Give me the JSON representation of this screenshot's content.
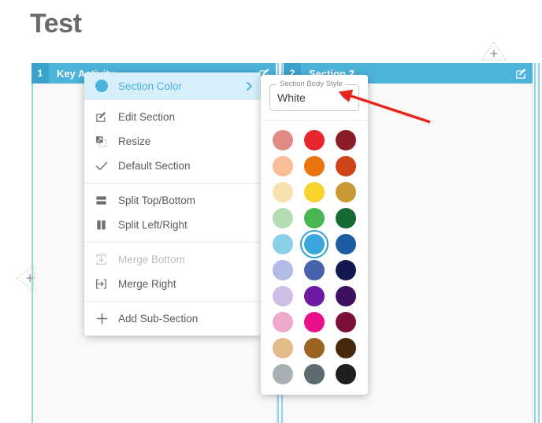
{
  "page": {
    "title": "Test"
  },
  "board": {
    "sections": [
      {
        "number": "1",
        "title": "Key Activity",
        "edit_icon": "edit-pencil-square-icon"
      },
      {
        "number": "2",
        "title": "Section 2",
        "edit_icon": "edit-pencil-square-icon"
      }
    ],
    "add_handles": [
      {
        "name": "add-section-top-handle",
        "icon": "plus-icon",
        "direction": "up"
      },
      {
        "name": "add-section-left-handle",
        "icon": "plus-icon",
        "direction": "left"
      }
    ],
    "colors": {
      "header_bar": "#4cb3da",
      "header_number_badge": "#3ba2cd",
      "guide_rule": "#8dd4ef",
      "canvas": "#f7f7f7"
    }
  },
  "context_menu": {
    "groups": [
      {
        "items": [
          {
            "label": "Section Color",
            "icon": "color-dot-icon",
            "highlight": true,
            "submenu": true,
            "caret_icon": "chevron-right-icon",
            "dot_color": "#4cb3da",
            "disabled": false
          }
        ]
      },
      {
        "items": [
          {
            "label": "Edit Section",
            "icon": "edit-pencil-square-icon",
            "highlight": false,
            "submenu": false,
            "disabled": false
          },
          {
            "label": "Resize",
            "icon": "resize-icon",
            "highlight": false,
            "submenu": false,
            "disabled": false
          },
          {
            "label": "Default Section",
            "icon": "check-icon",
            "highlight": false,
            "submenu": false,
            "disabled": false
          }
        ]
      },
      {
        "items": [
          {
            "label": "Split Top/Bottom",
            "icon": "split-horizontal-icon",
            "highlight": false,
            "submenu": false,
            "disabled": false
          },
          {
            "label": "Split Left/Right",
            "icon": "split-vertical-icon",
            "highlight": false,
            "submenu": false,
            "disabled": false
          }
        ]
      },
      {
        "items": [
          {
            "label": "Merge Bottom",
            "icon": "merge-bottom-icon",
            "highlight": false,
            "submenu": false,
            "disabled": true
          },
          {
            "label": "Merge Right",
            "icon": "merge-right-icon",
            "highlight": false,
            "submenu": false,
            "disabled": false
          }
        ]
      },
      {
        "items": [
          {
            "label": "Add Sub-Section",
            "icon": "plus-icon",
            "highlight": false,
            "submenu": false,
            "disabled": false
          }
        ]
      }
    ]
  },
  "color_panel": {
    "body_style": {
      "legend": "Section Body Style",
      "value": "White",
      "caret_icon": "chevron-down-icon",
      "options": [
        "White"
      ]
    },
    "swatches": [
      {
        "hex": "#e08c85",
        "selected": false
      },
      {
        "hex": "#e82630",
        "selected": false
      },
      {
        "hex": "#8a1c27",
        "selected": false
      },
      {
        "hex": "#f9bd98",
        "selected": false
      },
      {
        "hex": "#e8750e",
        "selected": false
      },
      {
        "hex": "#cc4418",
        "selected": false
      },
      {
        "hex": "#f7e2ae",
        "selected": false
      },
      {
        "hex": "#fad22e",
        "selected": false
      },
      {
        "hex": "#c79a35",
        "selected": false
      },
      {
        "hex": "#b5ddb4",
        "selected": false
      },
      {
        "hex": "#47b551",
        "selected": false
      },
      {
        "hex": "#156b33",
        "selected": false
      },
      {
        "hex": "#8bd0e8",
        "selected": false
      },
      {
        "hex": "#39a6dd",
        "selected": true
      },
      {
        "hex": "#1b5d9e",
        "selected": false
      },
      {
        "hex": "#b2bbe8",
        "selected": false
      },
      {
        "hex": "#4763ac",
        "selected": false
      },
      {
        "hex": "#12194f",
        "selected": false
      },
      {
        "hex": "#cfbde6",
        "selected": false
      },
      {
        "hex": "#6c1ba2",
        "selected": false
      },
      {
        "hex": "#40105e",
        "selected": false
      },
      {
        "hex": "#efa8cd",
        "selected": false
      },
      {
        "hex": "#e8108b",
        "selected": false
      },
      {
        "hex": "#7a1038",
        "selected": false
      },
      {
        "hex": "#e3bb8b",
        "selected": false
      },
      {
        "hex": "#9c6321",
        "selected": false
      },
      {
        "hex": "#44290c",
        "selected": false
      },
      {
        "hex": "#a7b0b5",
        "selected": false
      },
      {
        "hex": "#5d6a71",
        "selected": false
      },
      {
        "hex": "#1e1e1e",
        "selected": false
      }
    ]
  },
  "annotation": {
    "arrow_color": "#e8251a",
    "name": "red-pointer-arrow"
  }
}
